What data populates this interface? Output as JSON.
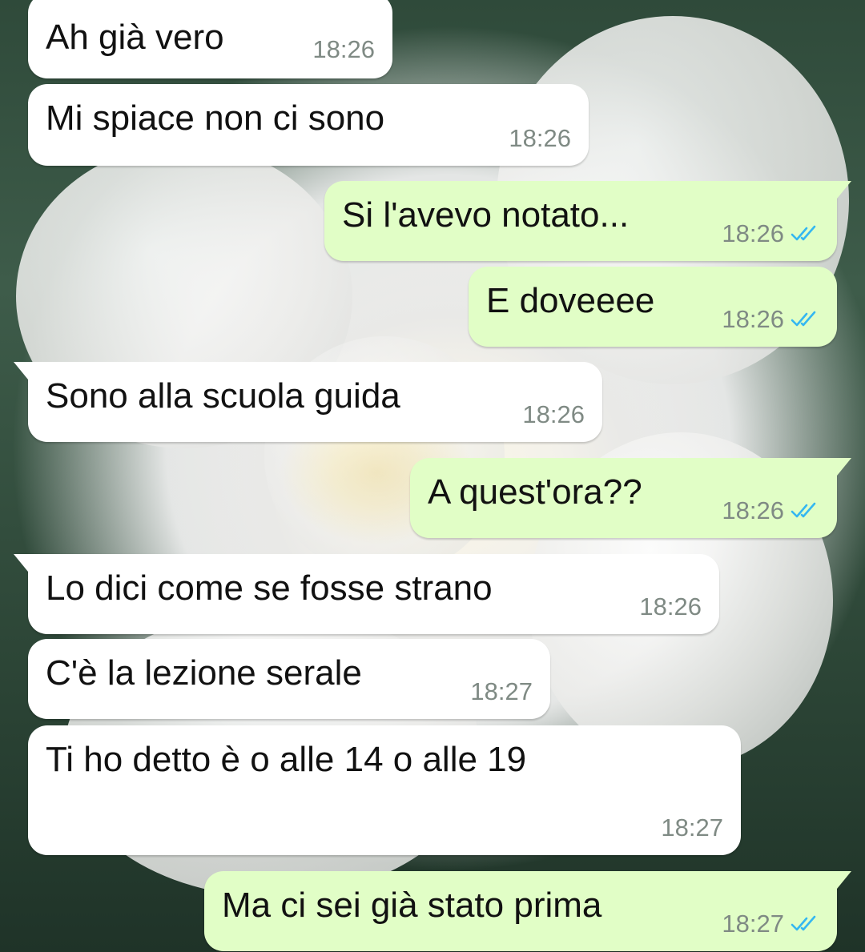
{
  "colors": {
    "incoming_bubble": "#ffffff",
    "outgoing_bubble": "#e1fec6",
    "message_text": "#111111",
    "timestamp": "#7f8a84",
    "read_ticks": "#34b7f1"
  },
  "wallpaper": {
    "subject": "white rose"
  },
  "messages": [
    {
      "direction": "incoming",
      "text": "Ah già vero",
      "time": "18:26",
      "status": ""
    },
    {
      "direction": "incoming",
      "text": "Mi spiace non ci sono",
      "time": "18:26",
      "status": ""
    },
    {
      "direction": "outgoing",
      "text": "Si l'avevo notato...",
      "time": "18:26",
      "status": "read",
      "status_icon": "double-check-icon"
    },
    {
      "direction": "outgoing",
      "text": "E doveeee",
      "time": "18:26",
      "status": "read",
      "status_icon": "double-check-icon"
    },
    {
      "direction": "incoming",
      "text": "Sono alla scuola guida",
      "time": "18:26",
      "status": ""
    },
    {
      "direction": "outgoing",
      "text": "A quest'ora??",
      "time": "18:26",
      "status": "read",
      "status_icon": "double-check-icon"
    },
    {
      "direction": "incoming",
      "text": "Lo dici come se fosse strano",
      "time": "18:26",
      "status": ""
    },
    {
      "direction": "incoming",
      "text": "C'è la lezione serale",
      "time": "18:27",
      "status": ""
    },
    {
      "direction": "incoming",
      "text": "Ti ho detto è o alle 14 o alle 19",
      "time": "18:27",
      "status": ""
    },
    {
      "direction": "outgoing",
      "text": "Ma ci sei già stato prima",
      "time": "18:27",
      "status": "read",
      "status_icon": "double-check-icon"
    }
  ]
}
